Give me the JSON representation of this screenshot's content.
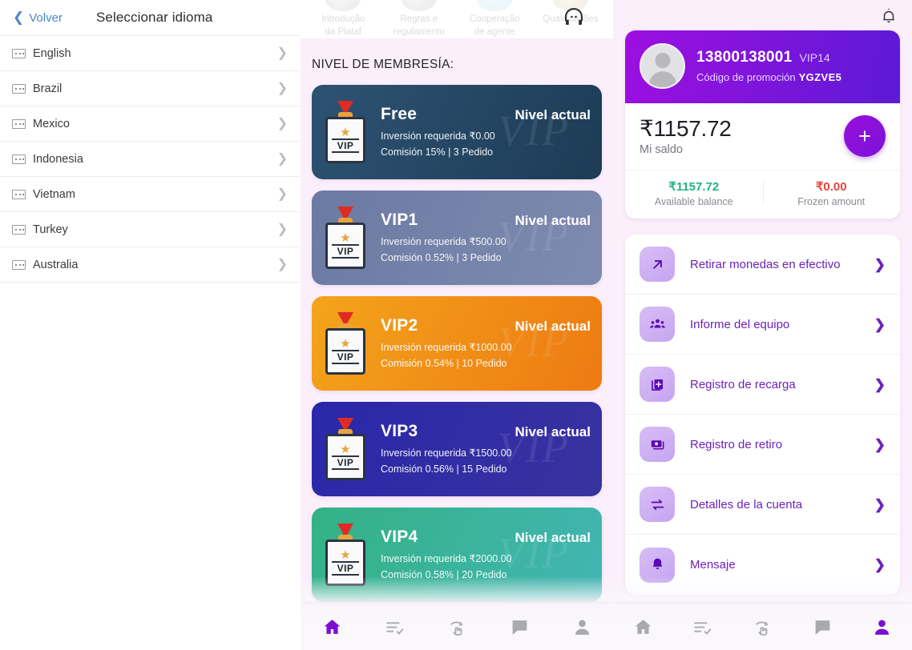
{
  "language_panel": {
    "back_label": "Volver",
    "title": "Seleccionar idioma",
    "items": [
      {
        "label": "English"
      },
      {
        "label": "Brazil"
      },
      {
        "label": "Mexico"
      },
      {
        "label": "Indonesia"
      },
      {
        "label": "Vietnam"
      },
      {
        "label": "Turkey"
      },
      {
        "label": "Australia"
      }
    ]
  },
  "vip_panel": {
    "top_shortcuts": [
      {
        "label_line1": "Introdução",
        "label_line2": "da Plataf"
      },
      {
        "label_line1": "Regras e",
        "label_line2": "regulamento"
      },
      {
        "label_line1": "Cooperação",
        "label_line2": "de agente"
      },
      {
        "label_line1": "Qualificações",
        "label_line2": ""
      }
    ],
    "section_title": "NIVEL DE MEMBRESÍA:",
    "watermark": "VIP",
    "levels": [
      {
        "name": "Free",
        "status": "Nivel actual",
        "investment": "Inversión requerida ₹0.00",
        "commission": "Comisión 15% | 3 Pedido",
        "color_from": "#2b4f6e",
        "color_to": "#1e3d58"
      },
      {
        "name": "VIP1",
        "status": "Nivel actual",
        "investment": "Inversión requerida ₹500.00",
        "commission": "Comisión 0.52% | 3 Pedido",
        "color_from": "#6d7ca4",
        "color_to": "#7b88ad"
      },
      {
        "name": "VIP2",
        "status": "Nivel actual",
        "investment": "Inversión requerida ₹1000.00",
        "commission": "Comisión 0.54% | 10 Pedido",
        "color_from": "#f0a020",
        "color_to": "#ef7d13"
      },
      {
        "name": "VIP3",
        "status": "Nivel actual",
        "investment": "Inversión requerida ₹1500.00",
        "commission": "Comisión 0.56% | 15 Pedido",
        "color_from": "#2a27aa",
        "color_to": "#36319f"
      },
      {
        "name": "VIP4",
        "status": "Nivel actual",
        "investment": "Inversión requerida ₹2000.00",
        "commission": "Comisión 0.58% | 20 Pedido",
        "color_from": "#35b187",
        "color_to": "#3fb5b0"
      }
    ]
  },
  "profile_panel": {
    "phone": "13800138001",
    "vip_badge": "VIP14",
    "promo_label": "Código de promoción",
    "promo_code": "YGZVE5",
    "balance_amount": "₹1157.72",
    "balance_label": "Mi saldo",
    "add_button": "+",
    "stats": [
      {
        "value": "₹1157.72",
        "label": "Available balance",
        "tone": "green"
      },
      {
        "value": "₹0.00",
        "label": "Frozen amount",
        "tone": "red"
      }
    ],
    "menu": [
      {
        "label": "Retirar monedas en efectivo",
        "icon": "arrow-up-right-icon"
      },
      {
        "label": "Informe del equipo",
        "icon": "team-icon"
      },
      {
        "label": "Registro de recarga",
        "icon": "recharge-icon"
      },
      {
        "label": "Registro de retiro",
        "icon": "withdraw-record-icon"
      },
      {
        "label": "Detalles de la cuenta",
        "icon": "exchange-icon"
      },
      {
        "label": "Mensaje",
        "icon": "bell-icon"
      }
    ]
  },
  "tabbar": {
    "items": [
      {
        "name": "home",
        "icon": "home-icon"
      },
      {
        "name": "orders",
        "icon": "task-list-icon"
      },
      {
        "name": "grab",
        "icon": "hand-tap-icon"
      },
      {
        "name": "chat",
        "icon": "chat-icon"
      },
      {
        "name": "profile",
        "icon": "person-icon"
      }
    ],
    "mid_active_index": 0,
    "right_active_index": 4
  },
  "theme": {
    "accent_purple": "#7b0fd0",
    "panel_bg": "#fbeffb",
    "link_blue": "#4a86c8"
  }
}
